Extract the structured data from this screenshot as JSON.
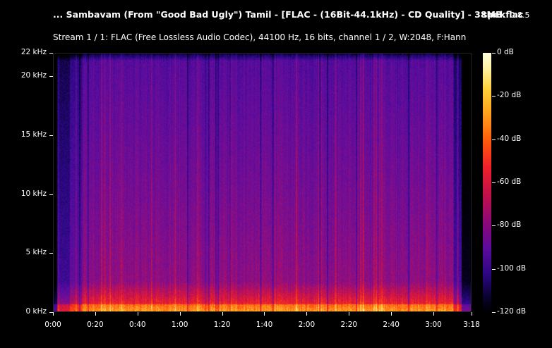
{
  "header": {
    "title": "... Sambavam (From \"Good Bad Ugly\") Tamil - [FLAC - (16Bit-44.1kHz) - CD Quality] - 38MB.flac",
    "app_name": "spek",
    "app_version": "0.8.5",
    "stream_info": "Stream 1 / 1: FLAC (Free Lossless Audio Codec), 44100 Hz, 16 bits, channel 1 / 2, W:2048, F:Hann"
  },
  "freq_axis": {
    "ticks": [
      {
        "label": "22 kHz",
        "value": 22
      },
      {
        "label": "20 kHz",
        "value": 20
      },
      {
        "label": "15 kHz",
        "value": 15
      },
      {
        "label": "10 kHz",
        "value": 10
      },
      {
        "label": "5 kHz",
        "value": 5
      },
      {
        "label": "0 kHz",
        "value": 0
      }
    ],
    "max": 22
  },
  "time_axis": {
    "ticks": [
      {
        "label": "0:00",
        "value": 0
      },
      {
        "label": "0:20",
        "value": 20
      },
      {
        "label": "0:40",
        "value": 40
      },
      {
        "label": "1:00",
        "value": 60
      },
      {
        "label": "1:20",
        "value": 80
      },
      {
        "label": "1:40",
        "value": 100
      },
      {
        "label": "2:00",
        "value": 120
      },
      {
        "label": "2:20",
        "value": 140
      },
      {
        "label": "2:40",
        "value": 160
      },
      {
        "label": "3:00",
        "value": 180
      },
      {
        "label": "3:18",
        "value": 198
      }
    ],
    "max": 198
  },
  "db_axis": {
    "ticks": [
      {
        "label": "0 dB",
        "value": 0
      },
      {
        "label": "-20 dB",
        "value": -20
      },
      {
        "label": "-40 dB",
        "value": -40
      },
      {
        "label": "-60 dB",
        "value": -60
      },
      {
        "label": "-80 dB",
        "value": -80
      },
      {
        "label": "-100 dB",
        "value": -100
      },
      {
        "label": "-120 dB",
        "value": -120
      }
    ],
    "min": -120
  },
  "colors": {
    "background": "#000000",
    "text": "#ffffff"
  }
}
